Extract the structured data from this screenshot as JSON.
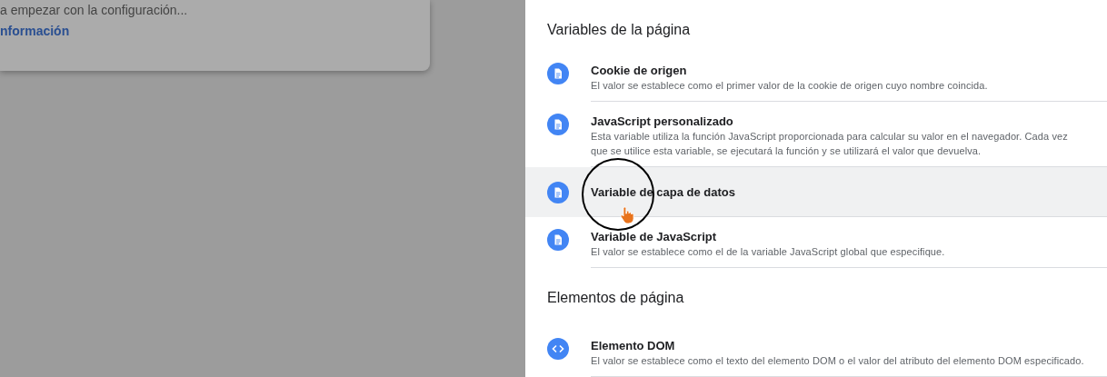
{
  "background_dialog": {
    "text": "a empezar con la configuración...",
    "link": "nformación"
  },
  "sections": [
    {
      "title": "Variables de la página",
      "items": [
        {
          "kind": "document",
          "title": "Cookie de origen",
          "description": "El valor se establece como el primer valor de la cookie de origen cuyo nombre coincida.",
          "hovered": false
        },
        {
          "kind": "document",
          "title": "JavaScript personalizado",
          "description": "Esta variable utiliza la función JavaScript proporcionada para calcular su valor en el navegador. Cada vez que se utilice esta variable, se ejecutará la función y se utilizará el valor que devuelva.",
          "hovered": false
        },
        {
          "kind": "document",
          "title": "Variable de capa de datos",
          "hovered": true
        },
        {
          "kind": "document",
          "title": "Variable de JavaScript",
          "description": "El valor se establece como el de la variable JavaScript global que especifique.",
          "hovered": false
        }
      ]
    },
    {
      "title": "Elementos de página",
      "items": [
        {
          "kind": "code",
          "title": "Elemento DOM",
          "description": "El valor se establece como el texto del elemento DOM o el valor del atributo del elemento DOM especificado.",
          "hovered": false
        }
      ]
    }
  ]
}
